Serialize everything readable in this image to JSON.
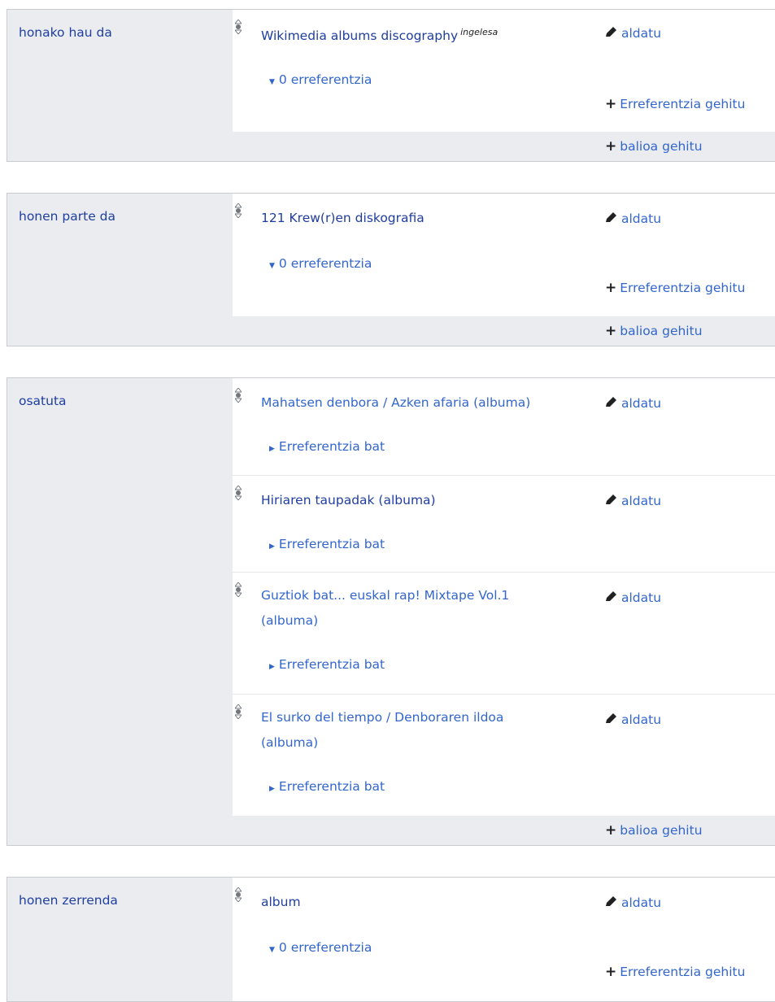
{
  "groups": [
    {
      "property": "honako hau da",
      "statements": [
        {
          "value": "Wikimedia albums discography",
          "lang": "ingelesa",
          "edit": "aldatu",
          "refs": "0 erreferentzia",
          "add_ref": "Erreferentzia gehitu"
        }
      ],
      "add_value": "balioa gehitu"
    },
    {
      "property": "honen parte da",
      "statements": [
        {
          "value": "121 Krew(r)en diskografia",
          "edit": "aldatu",
          "refs": "0 erreferentzia",
          "add_ref": "Erreferentzia gehitu"
        }
      ],
      "add_value": "balioa gehitu"
    },
    {
      "property": "osatuta",
      "statements": [
        {
          "value": "Mahatsen denbora / Azken afaria (albuma)",
          "edit": "aldatu",
          "refs": "Erreferentzia bat"
        },
        {
          "value": "Hiriaren taupadak (albuma)",
          "edit": "aldatu",
          "refs": "Erreferentzia bat"
        },
        {
          "value_line1": "Guztiok bat... euskal rap! Mixtape Vol.1",
          "value_line2": "(albuma)",
          "edit": "aldatu",
          "refs": "Erreferentzia bat"
        },
        {
          "value_line1": "El surko del tiempo / Denboraren ildoa",
          "value_line2": "(albuma)",
          "edit": "aldatu",
          "refs": "Erreferentzia bat"
        }
      ],
      "add_value": "balioa gehitu"
    },
    {
      "property": "honen zerrenda",
      "statements": [
        {
          "value": "album",
          "edit": "aldatu",
          "refs": "0 erreferentzia",
          "add_ref": "Erreferentzia gehitu"
        }
      ]
    }
  ],
  "icons": {
    "rank": "normal-rank-icon",
    "edit": "pencil-icon",
    "add": "plus-icon",
    "expanded": "triangle-down-icon",
    "collapsed": "triangle-right-icon"
  },
  "colors": {
    "link": "#3366cc",
    "visited_link": "#1f3ea0",
    "property_bg": "#eaecf0",
    "border": "#c8ccd1"
  }
}
